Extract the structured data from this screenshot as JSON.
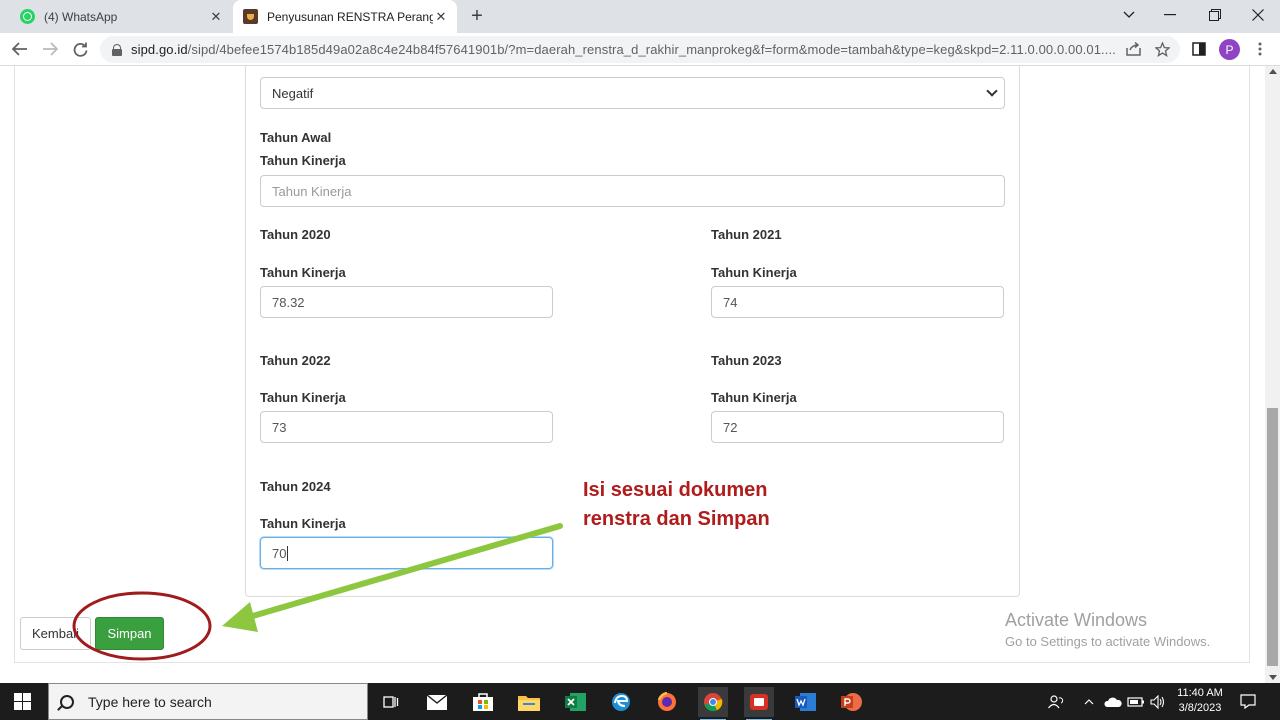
{
  "browser": {
    "tabs": [
      {
        "title": "(4) WhatsApp",
        "icon": "whatsapp-icon"
      },
      {
        "title": "Penyusunan RENSTRA Perangkat",
        "icon": "sipd-icon",
        "active": true
      }
    ],
    "url_host": "sipd.go.id",
    "url_path": "/sipd/4befee1574b185d49a02a8c4e24b84f57641901b/?m=daerah_renstra_d_rakhir_manprokeg&f=form&mode=tambah&type=keg&skpd=2.11.0.00.0.00.01....",
    "profile_initial": "P"
  },
  "form": {
    "status_select_value": "Negatif",
    "tahun_awal_label": "Tahun Awal",
    "kinerja_label": "Tahun Kinerja",
    "tahun_awal_placeholder": "Tahun Kinerja",
    "years": [
      {
        "label": "Tahun 2020",
        "value": "78.32"
      },
      {
        "label": "Tahun 2021",
        "value": "74"
      },
      {
        "label": "Tahun 2022",
        "value": "73"
      },
      {
        "label": "Tahun 2023",
        "value": "72"
      },
      {
        "label": "Tahun 2024",
        "value": "70"
      }
    ]
  },
  "buttons": {
    "back": "Kembali",
    "save": "Simpan"
  },
  "annotation": {
    "line1": "Isi sesuai dokumen",
    "line2": "renstra dan Simpan",
    "color": "#b01c1c",
    "arrow_color": "#8dc63f"
  },
  "watermark": {
    "title": "Activate Windows",
    "subtitle": "Go to Settings to activate Windows."
  },
  "taskbar": {
    "search_placeholder": "Type here to search",
    "time": "11:40 AM",
    "date": "3/8/2023"
  }
}
